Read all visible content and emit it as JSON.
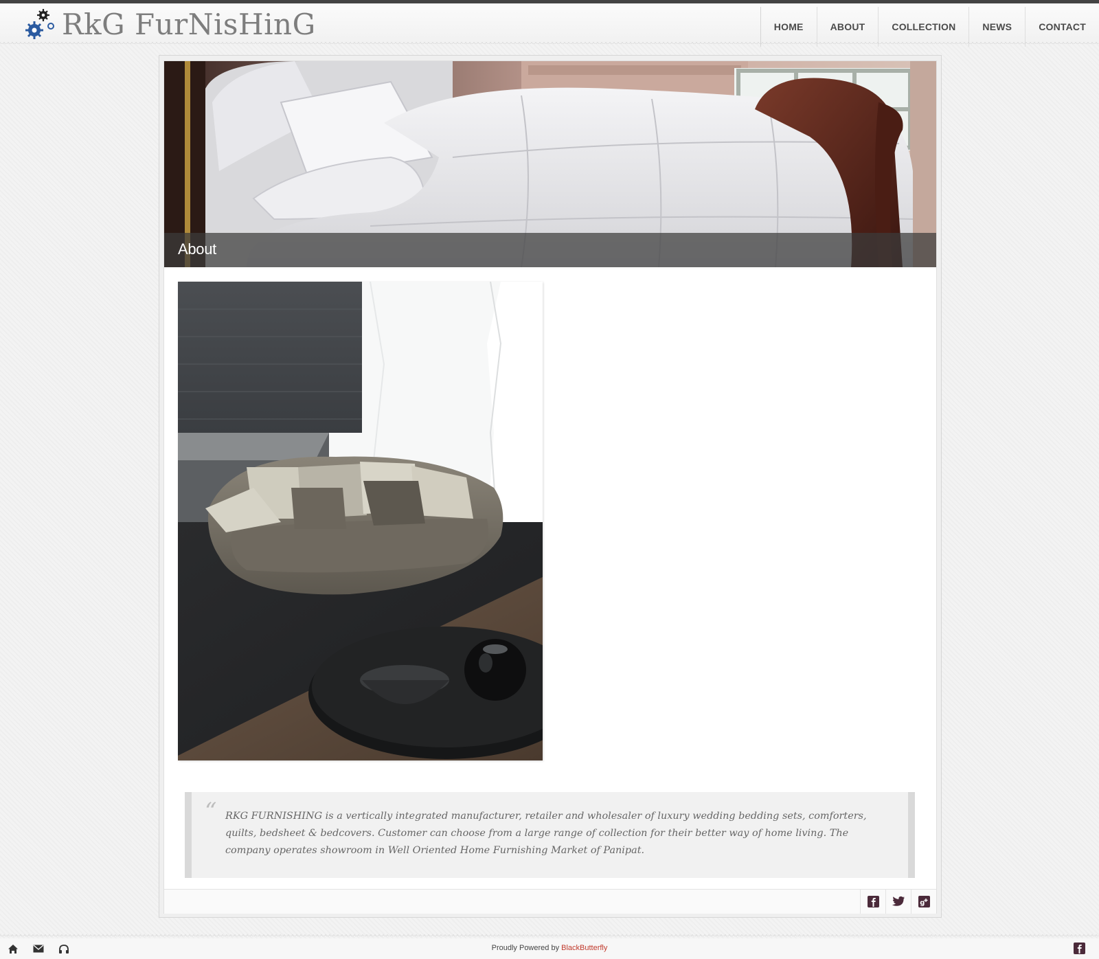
{
  "header": {
    "logo_text": "RkG FurNisHinG",
    "nav": [
      "HOME",
      "ABOUT",
      "COLLECTION",
      "NEWS",
      "CONTACT"
    ]
  },
  "page": {
    "hero_title": "About",
    "quote": " RKG FURNISHING is a vertically integrated manufacturer, retailer and wholesaler of luxury wedding bedding sets, comforters, quilts, bedsheet & bedcovers. Customer can choose from a large range of collection for their better way of home living. The company operates showroom in Well Oriented Home Furnishing Market of Panipat."
  },
  "social_icons": [
    "facebook-icon",
    "twitter-icon",
    "google-plus-icon"
  ],
  "footer": {
    "icons": [
      "home-icon",
      "mail-icon",
      "headphones-icon"
    ],
    "credit_prefix": "Proudly Powered by ",
    "credit_link": "BlackButterfly"
  },
  "colors": {
    "accent": "#c0392b",
    "nav_text": "#4a4a4a",
    "social_icon": "#4b2a3a",
    "logo_blue": "#2a5aa0"
  }
}
